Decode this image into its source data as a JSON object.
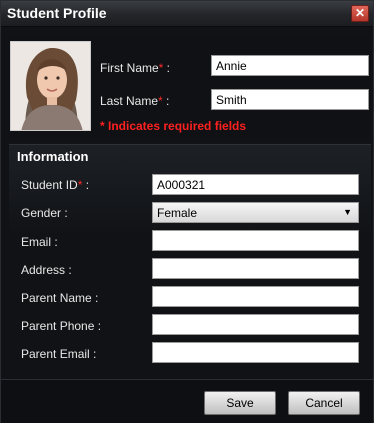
{
  "window": {
    "title": "Student Profile",
    "close_glyph": "✕"
  },
  "profile": {
    "first_name_label": "First Name",
    "first_name_value": "Annie",
    "last_name_label": "Last Name",
    "last_name_value": "Smith",
    "required_note": "* Indicates required fields"
  },
  "information": {
    "section_title": "Information",
    "fields": {
      "student_id": {
        "label": "Student ID",
        "value": "A000321"
      },
      "gender": {
        "label": "Gender :",
        "value": "Female"
      },
      "email": {
        "label": "Email :",
        "value": ""
      },
      "address": {
        "label": "Address :",
        "value": ""
      },
      "parent_name": {
        "label": "Parent Name :",
        "value": ""
      },
      "parent_phone": {
        "label": "Parent Phone :",
        "value": ""
      },
      "parent_email": {
        "label": "Parent Email :",
        "value": ""
      }
    }
  },
  "buttons": {
    "save": "Save",
    "cancel": "Cancel"
  },
  "glyphs": {
    "required_star": "*",
    "colon": " :",
    "caret": "▼"
  },
  "colors": {
    "required": "#ff2a2a",
    "background": "#101215"
  }
}
